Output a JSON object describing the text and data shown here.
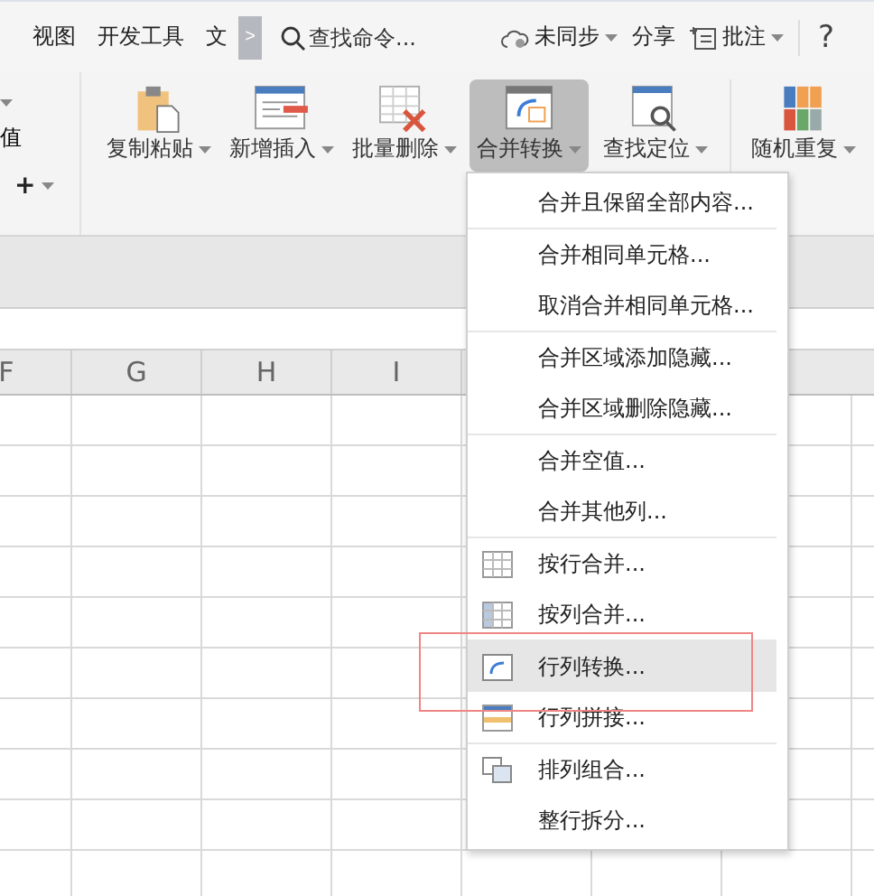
{
  "top_tabs": [
    {
      "label": "视图"
    },
    {
      "label": "开发工具"
    },
    {
      "label": "文"
    }
  ],
  "scroll_button": {
    "label": ">"
  },
  "search": {
    "placeholder": "查找命令..."
  },
  "top_actions": [
    {
      "label": "未同步",
      "kind": "sync"
    },
    {
      "label": "分享",
      "kind": "plain"
    },
    {
      "label": "批注",
      "kind": "comment"
    }
  ],
  "help": {
    "label": "?"
  },
  "ribbon_side": {
    "label": "值",
    "add": "+"
  },
  "ribbon_buttons": [
    {
      "label": "复制粘贴",
      "selected": false
    },
    {
      "label": "新增插入",
      "selected": false
    },
    {
      "label": "批量删除",
      "selected": false
    },
    {
      "label": "合并转换",
      "selected": true
    },
    {
      "label": "查找定位",
      "selected": false
    },
    {
      "label": "随机重复",
      "selected": false
    }
  ],
  "columns": [
    "F",
    "G",
    "H",
    "I"
  ],
  "menu": {
    "groups": [
      {
        "items": [
          {
            "label": "合并且保留全部内容...",
            "kind": "text",
            "selected": false
          }
        ]
      },
      {
        "items": [
          {
            "label": "合并相同单元格...",
            "kind": "text",
            "selected": false
          },
          {
            "label": "取消合并相同单元格...",
            "kind": "text",
            "selected": false
          }
        ]
      },
      {
        "items": [
          {
            "label": "合并区域添加隐藏...",
            "kind": "text",
            "selected": false
          },
          {
            "label": "合并区域删除隐藏...",
            "kind": "text",
            "selected": false
          }
        ]
      },
      {
        "items": [
          {
            "label": "合并空值...",
            "kind": "text",
            "selected": false
          },
          {
            "label": "合并其他列...",
            "kind": "text",
            "selected": false
          }
        ]
      },
      {
        "items": [
          {
            "label": "按行合并...",
            "kind": "icon",
            "selected": false
          },
          {
            "label": "按列合并...",
            "kind": "icon",
            "selected": false
          }
        ]
      },
      {
        "items": [
          {
            "label": "行列转换...",
            "kind": "icon",
            "selected": true
          },
          {
            "label": "行列拼接...",
            "kind": "icon",
            "selected": false
          }
        ]
      },
      {
        "items": [
          {
            "label": "排列组合...",
            "kind": "icon",
            "selected": false
          },
          {
            "label": "整行拆分...",
            "kind": "text",
            "selected": false
          }
        ]
      }
    ]
  },
  "highlight_frame": {
    "shown": true
  }
}
